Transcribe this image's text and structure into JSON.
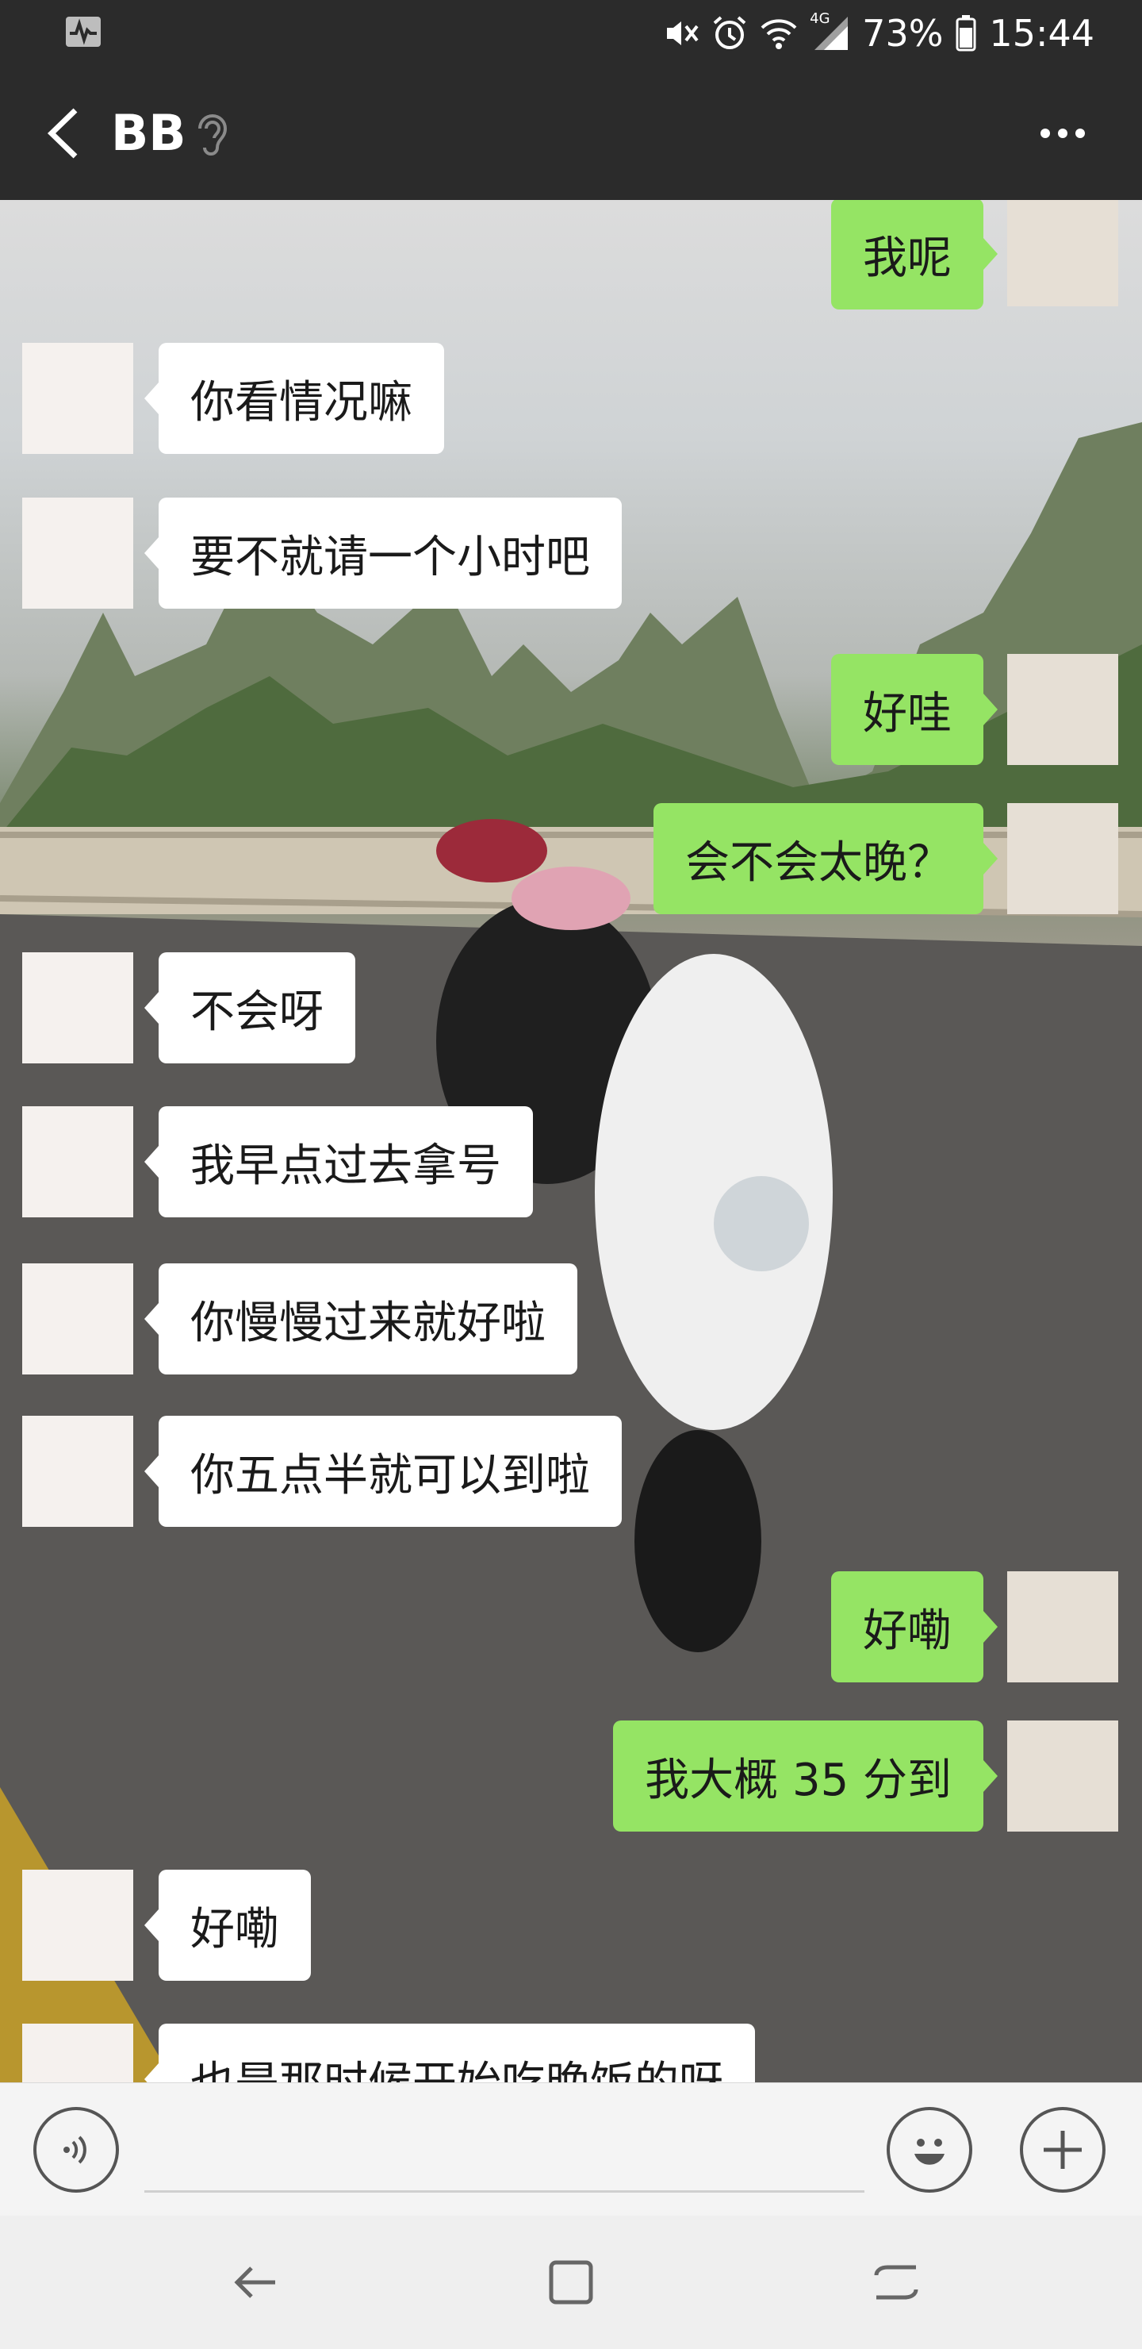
{
  "status_bar": {
    "network": "4G",
    "battery": "73%",
    "time": "15:44",
    "icons": [
      "activity-icon",
      "mute-icon",
      "alarm-icon",
      "wifi-icon",
      "signal-icon",
      "battery-icon"
    ]
  },
  "header": {
    "title": "BB",
    "icons": [
      "back-arrow-icon",
      "ear-icon",
      "more-icon"
    ]
  },
  "messages": [
    {
      "side": "right",
      "text": "我呢"
    },
    {
      "side": "left",
      "text": "你看情况嘛"
    },
    {
      "side": "left",
      "text": "要不就请一个小时吧"
    },
    {
      "side": "right",
      "text": "好哇"
    },
    {
      "side": "right",
      "text": "会不会太晚？"
    },
    {
      "side": "left",
      "text": "不会呀"
    },
    {
      "side": "left",
      "text": "我早点过去拿号"
    },
    {
      "side": "left",
      "text": "你慢慢过来就好啦"
    },
    {
      "side": "left",
      "text": "你五点半就可以到啦"
    },
    {
      "side": "right",
      "text": "好嘞"
    },
    {
      "side": "right",
      "text": "我大概 35 分到"
    },
    {
      "side": "left",
      "text": "好嘞"
    },
    {
      "side": "left",
      "text": "也是那时候开始吃晚饭的呀"
    }
  ],
  "input_bar": {
    "icons": [
      "voice-icon",
      "emoji-icon",
      "plus-icon"
    ],
    "value": ""
  },
  "nav_bar": {
    "icons": [
      "nav-back-icon",
      "recents-icon",
      "home-switch-icon"
    ]
  },
  "colors": {
    "header_bg": "#2b2b2b",
    "sent_bubble": "#95e464",
    "received_bubble": "#ffffff",
    "input_bg": "#f4f4f4",
    "nav_bg": "#efefef"
  }
}
